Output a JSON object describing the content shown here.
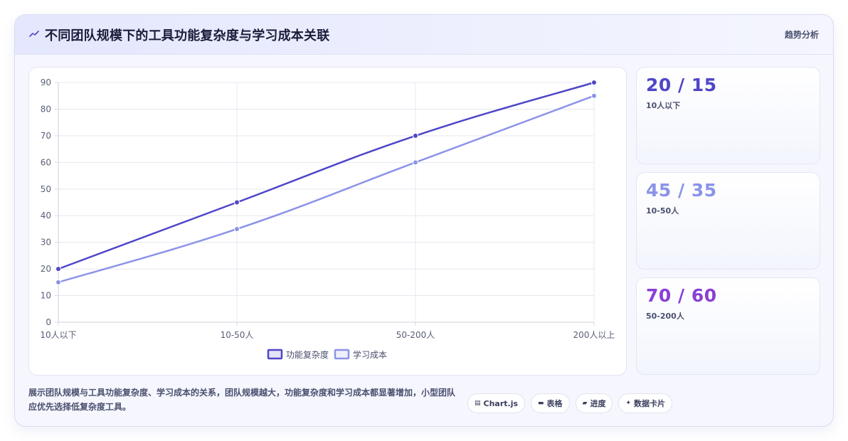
{
  "header": {
    "icon": "trend-line-icon",
    "title": "不同团队规模下的工具功能复杂度与学习成本关联",
    "badge": "趋势分析"
  },
  "chart_data": {
    "type": "line",
    "categories": [
      "10人以下",
      "10-50人",
      "50-200人",
      "200人以上"
    ],
    "series": [
      {
        "name": "功能复杂度",
        "values": [
          20,
          45,
          70,
          90
        ],
        "color": "#4f46c8"
      },
      {
        "name": "学习成本",
        "values": [
          15,
          35,
          60,
          85
        ],
        "color": "#8b93e8"
      }
    ],
    "ylim": [
      0,
      90
    ],
    "yticks": [
      0,
      10,
      20,
      30,
      40,
      50,
      60,
      70,
      80,
      90
    ],
    "grid": true,
    "legend": "bottom-center"
  },
  "stats": [
    {
      "value": "20 / 15",
      "label": "10人以下",
      "color": "#4f46c8"
    },
    {
      "value": "45 / 35",
      "label": "10-50人",
      "color": "#8b93e8"
    },
    {
      "value": "70 / 60",
      "label": "50-200人",
      "color": "#8a3fd6"
    }
  ],
  "description": "展示团队规模与工具功能复杂度、学习成本的关系，团队规模越大，功能复杂度和学习成本都显著增加，小型团队应优先选择低复杂度工具。",
  "tags": [
    {
      "icon": "chart-icon",
      "glyph": "▤",
      "label": "Chart.js"
    },
    {
      "icon": "table-icon",
      "glyph": "▬",
      "label": "表格"
    },
    {
      "icon": "progress-icon",
      "glyph": "▰",
      "label": "进度"
    },
    {
      "icon": "sparkle-icon",
      "glyph": "✦",
      "label": "数据卡片"
    }
  ]
}
